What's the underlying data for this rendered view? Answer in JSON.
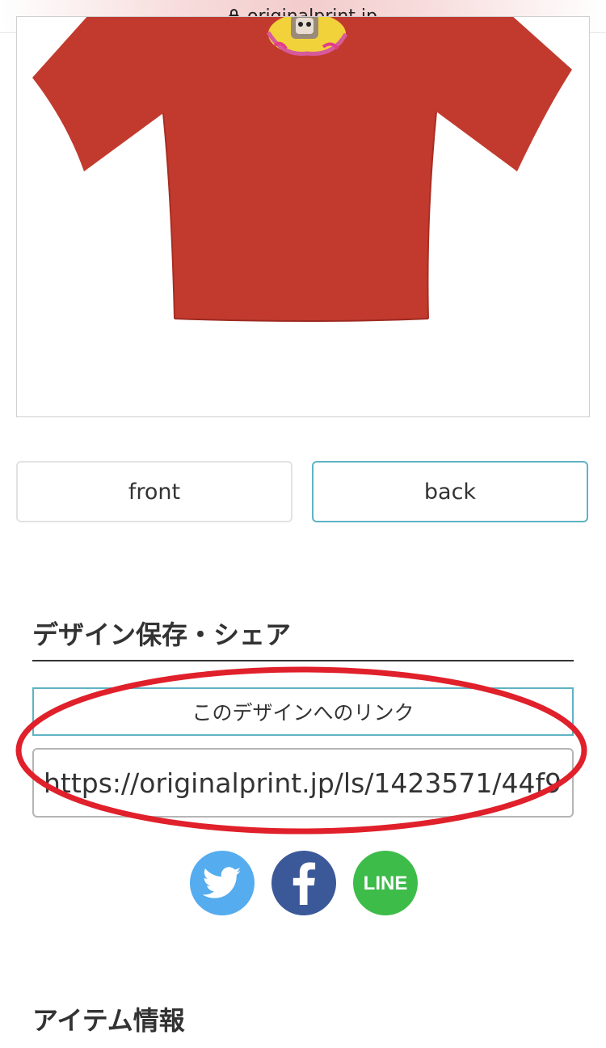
{
  "browser": {
    "url": "originalprint.jp"
  },
  "product": {
    "shirt_color": "#c23a2e"
  },
  "view_buttons": {
    "front": "front",
    "back": "back"
  },
  "share_section": {
    "heading": "デザイン保存・シェア",
    "link_label": "このデザインへのリンク",
    "link_value": "https://originalprint.jp/ls/1423571/44f9",
    "social": [
      {
        "name": "twitter-icon",
        "color": "#55acee"
      },
      {
        "name": "facebook-icon",
        "color": "#3b5998"
      },
      {
        "name": "line-icon",
        "color": "#3ebc4a"
      }
    ]
  },
  "item_section": {
    "heading": "アイテム情報"
  },
  "annotation": {
    "color": "#e0202a"
  },
  "colors": {
    "accent_border": "#5fb3c4"
  }
}
